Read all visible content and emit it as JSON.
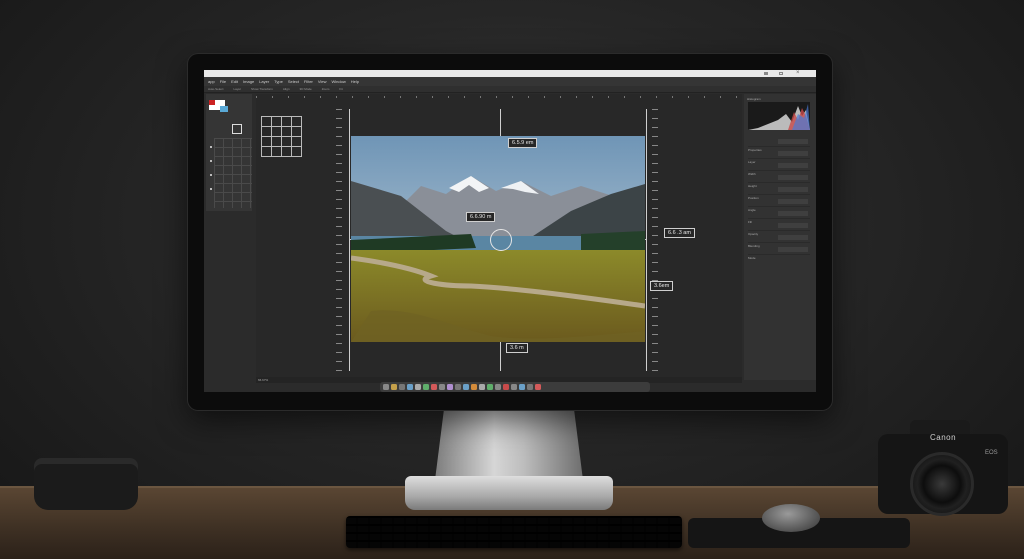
{
  "app": {
    "menus": [
      "app",
      "File",
      "Edit",
      "Image",
      "Layer",
      "Type",
      "Select",
      "Filter",
      "View",
      "Window",
      "Help"
    ],
    "toolbar_options": [
      "Auto-Select",
      "Layer",
      "Show Transform",
      "Align",
      "3D Mode",
      "Zoom",
      "Fit"
    ]
  },
  "canvas": {
    "measurements": {
      "top": "6.5.9 em",
      "center": "6.6.90 m",
      "right_upper": "6.6 .3 am",
      "right_lower": "3.6em",
      "bottom": "3.6 m"
    }
  },
  "right_panel": {
    "title": "Histogram",
    "rows": [
      "Properties",
      "Layer",
      "Width",
      "Height",
      "Position",
      "Angle",
      "Fill",
      "Opacity",
      "Blending",
      "Mode"
    ]
  },
  "status": {
    "zoom": "66.67%"
  },
  "camera": {
    "brand": "Canon",
    "model": "EOS"
  },
  "colors": {
    "screen_bg": "#2b2b2b",
    "panel_bg": "#323232",
    "accent": "#d0d0d0"
  }
}
